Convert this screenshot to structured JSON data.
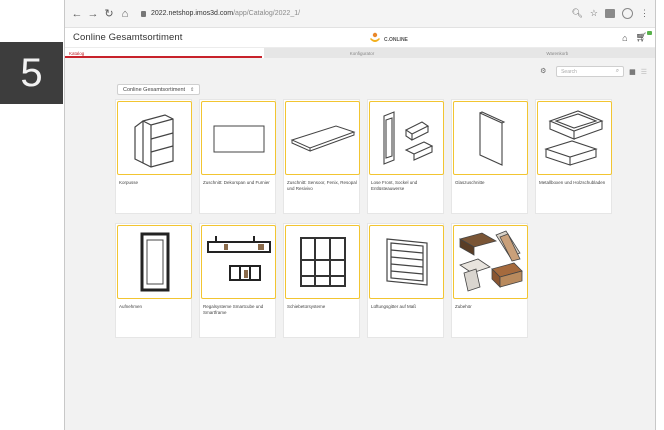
{
  "step_badge": "5",
  "browser": {
    "url_host": "2022.netshop.imos3d.com",
    "url_path": "/app/Catalog/2022_1/"
  },
  "app": {
    "title": "Conline Gesamtsortiment",
    "logo_text": "C.ONLINE"
  },
  "steps": [
    {
      "label": "Katalog",
      "active": true
    },
    {
      "label": "Konfigurator",
      "active": false
    },
    {
      "label": "Warenkorb",
      "active": false
    }
  ],
  "search": {
    "placeholder": "Search"
  },
  "dropdown": {
    "selected": "Conline Gesamtsortiment"
  },
  "products": [
    {
      "label": "Korpusse",
      "icon": "cabinet-icon"
    },
    {
      "label": "Zuschnitt: Dekorspan und Furnier",
      "icon": "panel-icon"
    },
    {
      "label": "Zuschnitt: Sensoor, Fenix, Resopal und Resivivo",
      "icon": "board-icon"
    },
    {
      "label": "Lose Front, Sockel und Entlüsteauwerse",
      "icon": "front-parts-icon"
    },
    {
      "label": "Glaszuschnitte",
      "icon": "glass-panel-icon"
    },
    {
      "label": "Metallboxen und Holzschubladen",
      "icon": "drawers-icon"
    },
    {
      "label": "Aufnehmen",
      "icon": "frame-door-icon"
    },
    {
      "label": "Regalsysteme Smartcube und Smartframe",
      "icon": "shelf-system-icon"
    },
    {
      "label": "Schiebetürsysteme",
      "icon": "sliding-door-icon"
    },
    {
      "label": "Lüftungsgitter auf Maß",
      "icon": "vent-grille-icon"
    },
    {
      "label": "Zubehör",
      "icon": "accessories-icon"
    }
  ],
  "colors": {
    "accent": "#c8222b",
    "card_border": "#f2c531",
    "badge_bg": "#3d3d3d"
  }
}
